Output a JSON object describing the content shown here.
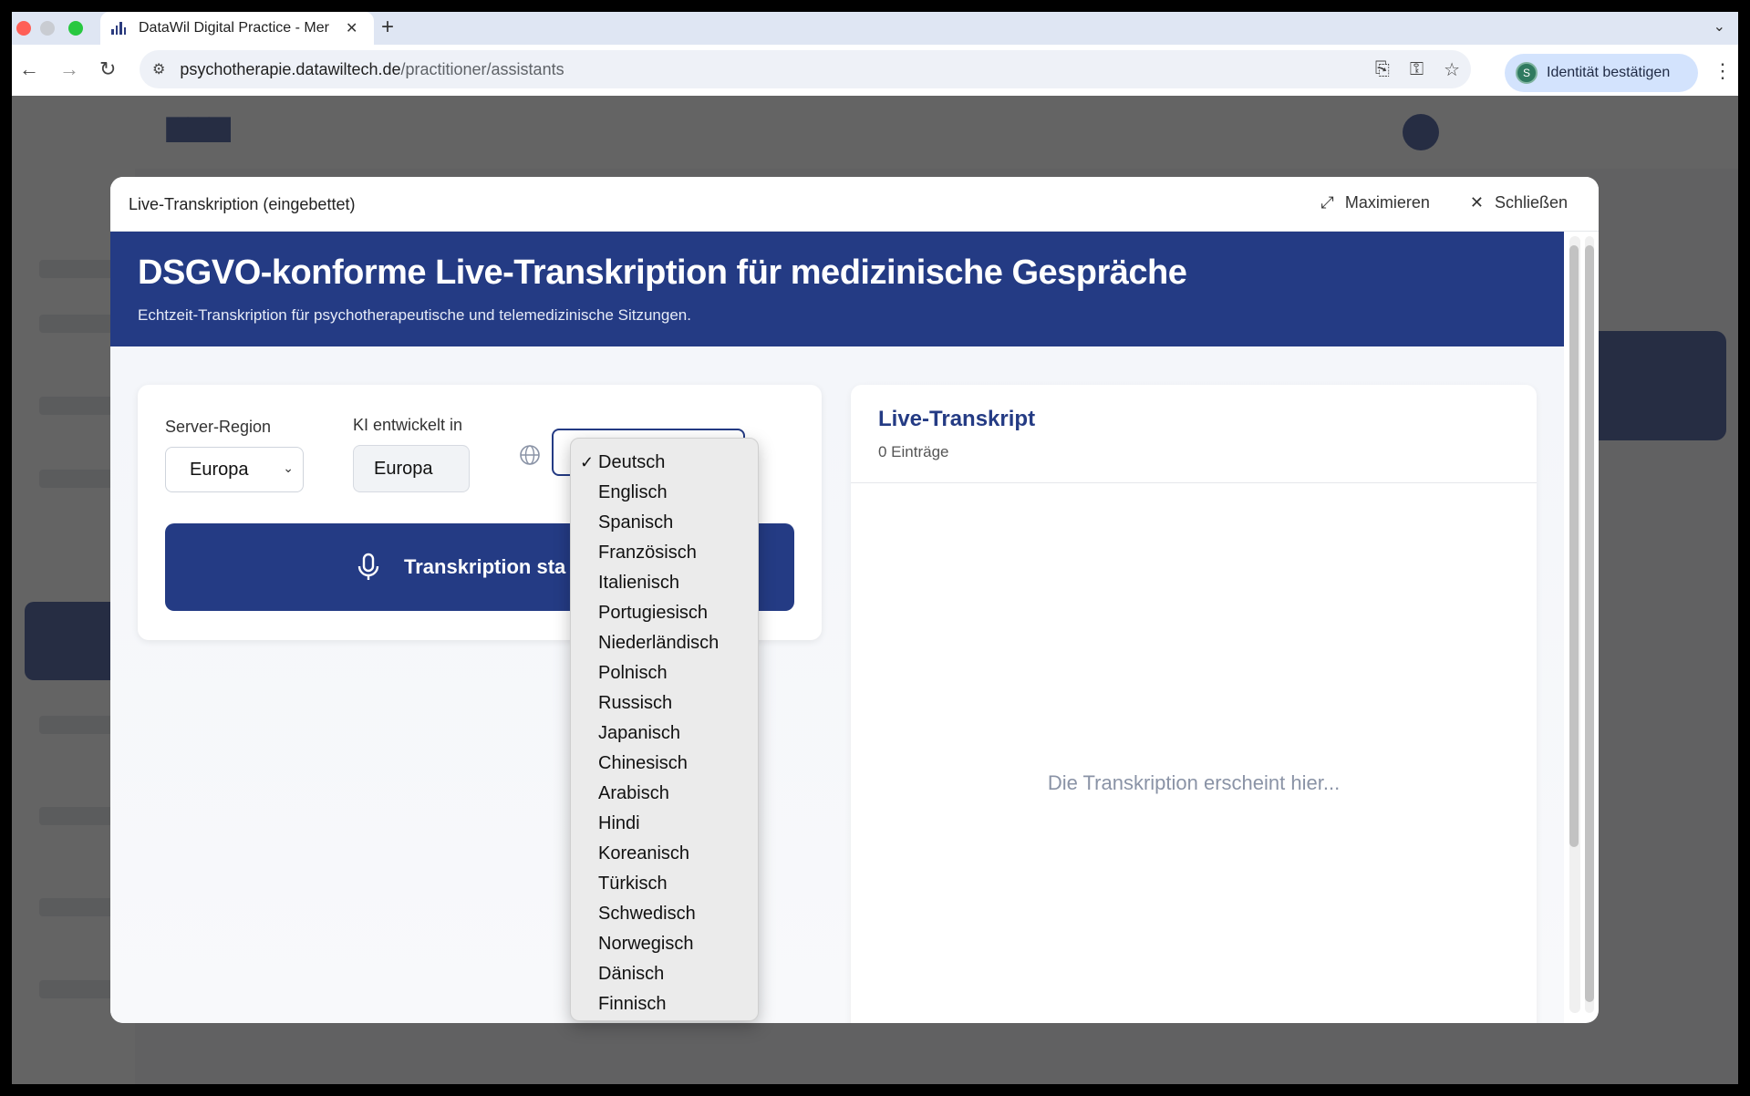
{
  "browser": {
    "tab_title": "DataWil Digital Practice - Mer",
    "url_host": "psychotherapie.datawiltech.de",
    "url_path": "/practitioner/assistants",
    "identity_label": "Identität bestätigen",
    "identity_initial": "S"
  },
  "modal": {
    "title": "Live-Transkription (eingebettet)",
    "maximize_label": "Maximieren",
    "close_label": "Schließen"
  },
  "banner": {
    "title": "DSGVO-konforme Live-Transkription für medizinische Gespräche",
    "subtitle": "Echtzeit-Transkription für psychotherapeutische und telemedizinische Sitzungen."
  },
  "controls": {
    "region_label": "Server-Region",
    "region_value": "Europa",
    "ki_label": "KI entwickelt in",
    "ki_value": "Europa",
    "start_button": "Transkription sta"
  },
  "language_dropdown": {
    "selected": "Deutsch",
    "options": [
      "Deutsch",
      "Englisch",
      "Spanisch",
      "Französisch",
      "Italienisch",
      "Portugiesisch",
      "Niederländisch",
      "Polnisch",
      "Russisch",
      "Japanisch",
      "Chinesisch",
      "Arabisch",
      "Hindi",
      "Koreanisch",
      "Türkisch",
      "Schwedisch",
      "Norwegisch",
      "Dänisch",
      "Finnisch"
    ]
  },
  "transcript": {
    "title": "Live-Transkript",
    "count": "0 Einträge",
    "placeholder": "Die Transkription erscheint hier..."
  },
  "colors": {
    "brand": "#243b84",
    "overlay": "#282828"
  }
}
